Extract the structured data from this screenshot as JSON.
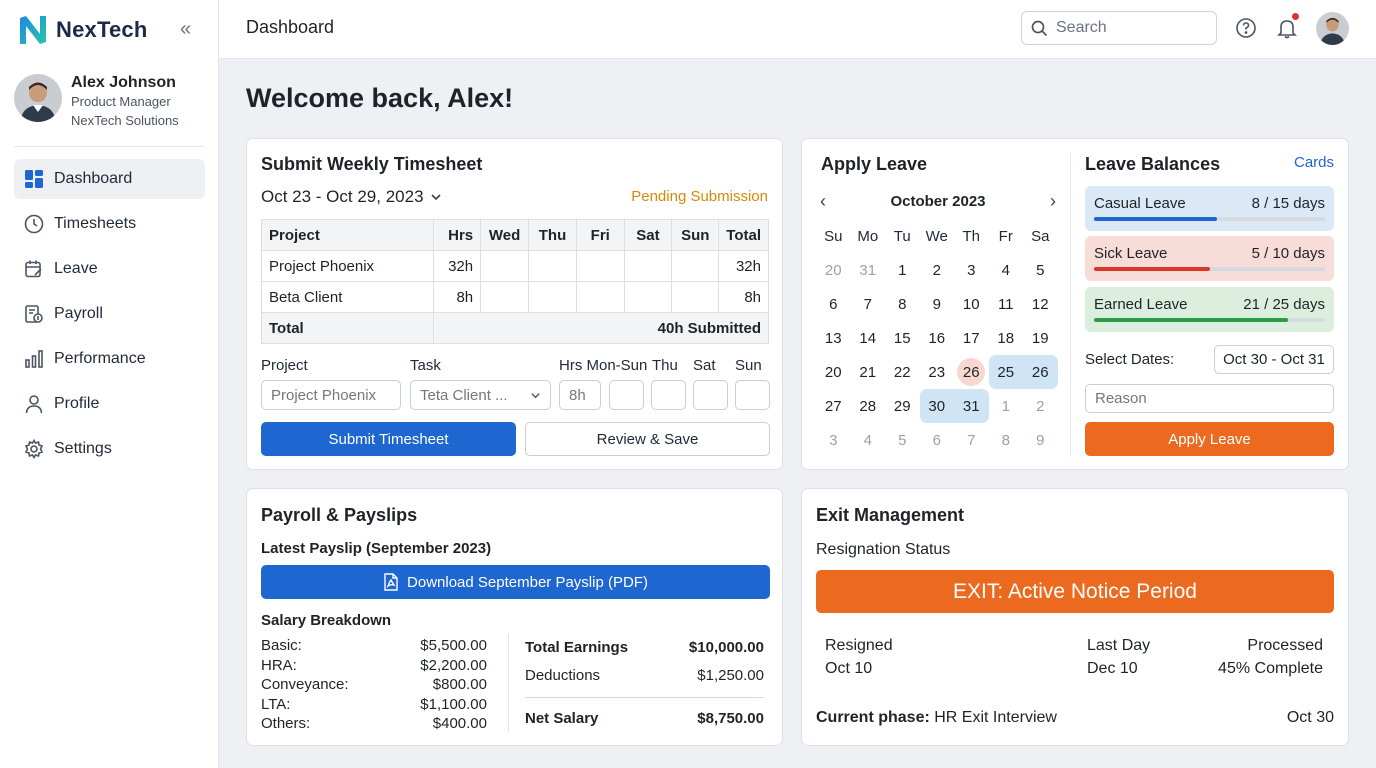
{
  "brand": {
    "name": "NexTech"
  },
  "user": {
    "name": "Alex Johnson",
    "role": "Product Manager",
    "org": "NexTech Solutions"
  },
  "nav": [
    {
      "label": "Dashboard",
      "icon": "dashboard-icon",
      "active": true
    },
    {
      "label": "Timesheets",
      "icon": "clock-icon"
    },
    {
      "label": "Leave",
      "icon": "calendar-edit-icon"
    },
    {
      "label": "Payroll",
      "icon": "payroll-icon"
    },
    {
      "label": "Performance",
      "icon": "bar-chart-icon"
    },
    {
      "label": "Profile",
      "icon": "user-icon"
    },
    {
      "label": "Settings",
      "icon": "gear-icon"
    }
  ],
  "topbar": {
    "title": "Dashboard",
    "search_placeholder": "Search"
  },
  "welcome": "Welcome back, Alex!",
  "timesheet": {
    "title": "Submit Weekly Timesheet",
    "week": "Oct 23 - Oct 29, 2023",
    "status": "Pending Submission",
    "columns": [
      "Project",
      "Hrs",
      "Wed",
      "Thu",
      "Fri",
      "Sat",
      "Sun",
      "Total"
    ],
    "rows": [
      {
        "project": "Project Phoenix",
        "hrs": "32h",
        "total": "32h"
      },
      {
        "project": "Beta Client",
        "hrs": "8h",
        "total": "8h"
      }
    ],
    "total_label": "Total",
    "total_value": "40h Submitted",
    "form": {
      "project_label": "Project",
      "task_label": "Task",
      "hrs_label": "Hrs Mon-Sun",
      "thu_label": "Thu",
      "sat_label": "Sat",
      "sun_label": "Sun",
      "project_value": "Project Phoenix",
      "task_value": "Teta Client ...",
      "hrs_value": "8h"
    },
    "submit_label": "Submit Timesheet",
    "review_label": "Review & Save"
  },
  "leave": {
    "title": "Apply Leave",
    "month": "October 2023",
    "weekdays": [
      "Su",
      "Mo",
      "Tu",
      "We",
      "Th",
      "Fr",
      "Sa"
    ],
    "weeks": [
      [
        "20",
        "31",
        "1",
        "2",
        "3",
        "4",
        "5"
      ],
      [
        "6",
        "7",
        "8",
        "9",
        "10",
        "11",
        "12"
      ],
      [
        "13",
        "14",
        "15",
        "16",
        "17",
        "18",
        "19"
      ],
      [
        "20",
        "21",
        "22",
        "23",
        "26",
        "25",
        "26"
      ],
      [
        "27",
        "28",
        "29",
        "30",
        "31",
        "1",
        "2"
      ],
      [
        "3",
        "4",
        "5",
        "6",
        "7",
        "8",
        "9"
      ]
    ],
    "balances_title": "Leave Balances",
    "cards_link": "Cards",
    "balances": [
      {
        "name": "Casual Leave",
        "value": "8 / 15 days",
        "progress": 0.533,
        "bg": "#dbe9f7",
        "color": "#1e66d0"
      },
      {
        "name": "Sick Leave",
        "value": "5 / 10 days",
        "progress": 0.5,
        "bg": "#f7dcd8",
        "color": "#d9372b"
      },
      {
        "name": "Earned Leave",
        "value": "21 / 25 days",
        "progress": 0.84,
        "bg": "#dcefdf",
        "color": "#2e9b4a"
      }
    ],
    "select_label": "Select Dates:",
    "dates_value": "Oct 30 - Oct 31",
    "reason_placeholder": "Reason",
    "apply_label": "Apply Leave"
  },
  "payroll": {
    "title": "Payroll & Payslips",
    "latest": "Latest Payslip (September 2023)",
    "download_label": "Download September Payslip (PDF)",
    "breakdown_title": "Salary Breakdown",
    "breakdown": [
      {
        "label": "Basic:",
        "value": "$5,500.00"
      },
      {
        "label": "HRA:",
        "value": "$2,200.00"
      },
      {
        "label": "Conveyance:",
        "value": "$800.00"
      },
      {
        "label": "LTA:",
        "value": "$1,100.00"
      },
      {
        "label": "Others:",
        "value": "$400.00"
      }
    ],
    "total_earnings_label": "Total Earnings",
    "total_earnings": "$10,000.00",
    "deductions_label": "Deductions",
    "deductions": "$1,250.00",
    "net_label": "Net Salary",
    "net": "$8,750.00"
  },
  "exit": {
    "title": "Exit Management",
    "subtitle": "Resignation Status",
    "banner": "EXIT: Active Notice Period",
    "resigned_label": "Resigned",
    "resigned_date": "Oct 10",
    "lastday_label": "Last Day",
    "lastday_date": "Dec 10",
    "processed_label": "Processed",
    "processed_value": "45% Complete",
    "phase_label": "Current phase:",
    "phase_value": "HR Exit Interview",
    "phase_date": "Oct 30"
  },
  "colors": {
    "primary": "#1e66d0",
    "accent": "#ec6a20",
    "pending": "#d58a0a"
  }
}
